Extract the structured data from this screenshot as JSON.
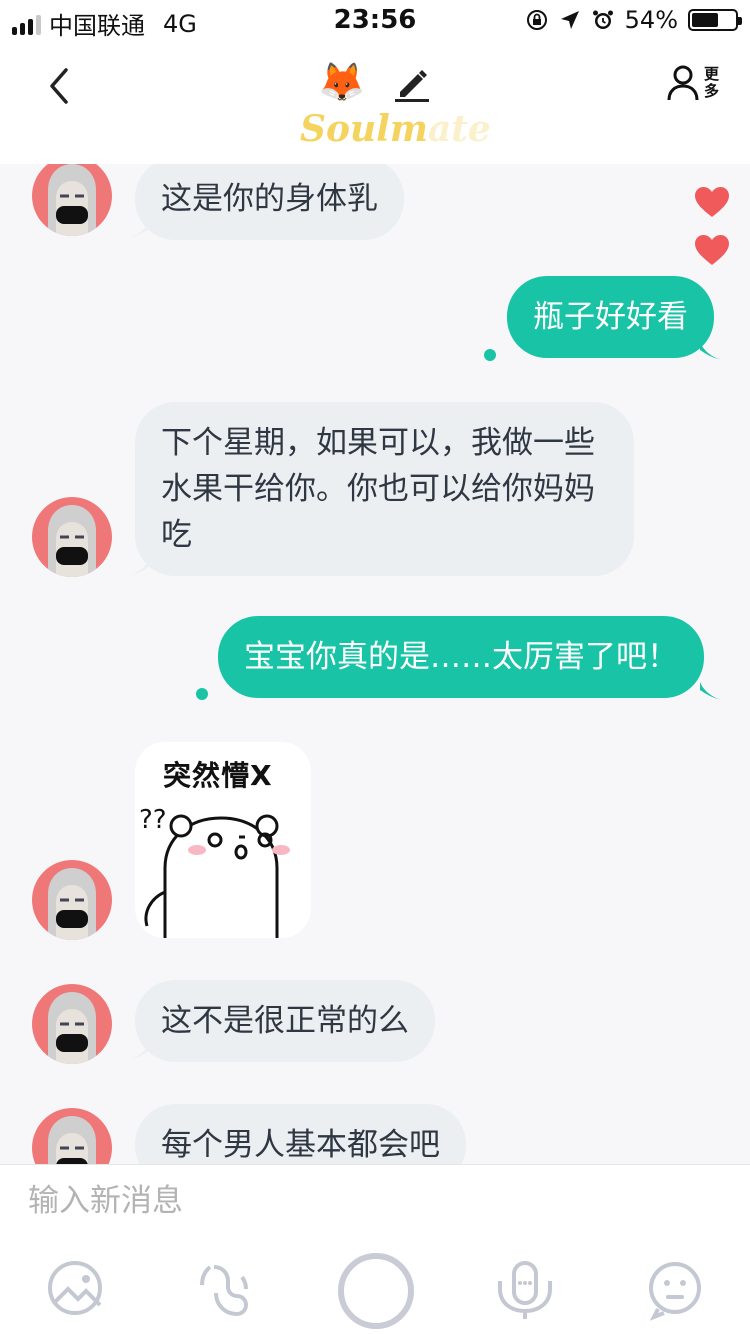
{
  "status_bar": {
    "carrier": "中国联通",
    "network": "4G",
    "time": "23:56",
    "battery_percent": "54%",
    "battery_level": 0.54
  },
  "header": {
    "logo_main": "Soulm",
    "logo_fade": "ate",
    "more_label_1": "更",
    "more_label_2": "多",
    "fox_emoji": "🦊"
  },
  "messages": [
    {
      "side": "in",
      "text": "这是你的身体乳"
    },
    {
      "side": "out",
      "text": "瓶子好好看",
      "liked": true
    },
    {
      "side": "in",
      "lines": [
        "下个星期，如果可以，我做一些",
        "水果干给你。你也可以给你妈妈",
        "吃"
      ]
    },
    {
      "side": "out",
      "text": "宝宝你真的是……太厉害了吧！"
    },
    {
      "side": "in",
      "type": "sticker",
      "sticker_text": "突然懵X",
      "sticker_marks": "??"
    },
    {
      "side": "in",
      "text": "这不是很正常的么"
    },
    {
      "side": "in",
      "text": "每个男人基本都会吧"
    }
  ],
  "input": {
    "placeholder": "输入新消息"
  },
  "toolbar": {
    "icons": [
      "image-icon",
      "voice-call-icon",
      "record-button",
      "voice-message-icon",
      "emoji-icon"
    ]
  },
  "colors": {
    "accent": "#19c3a5",
    "incoming_bubble": "#eceff2",
    "heart": "#f05a5a",
    "avatar_bg": "#f07777",
    "logo": "#f4d35e"
  }
}
